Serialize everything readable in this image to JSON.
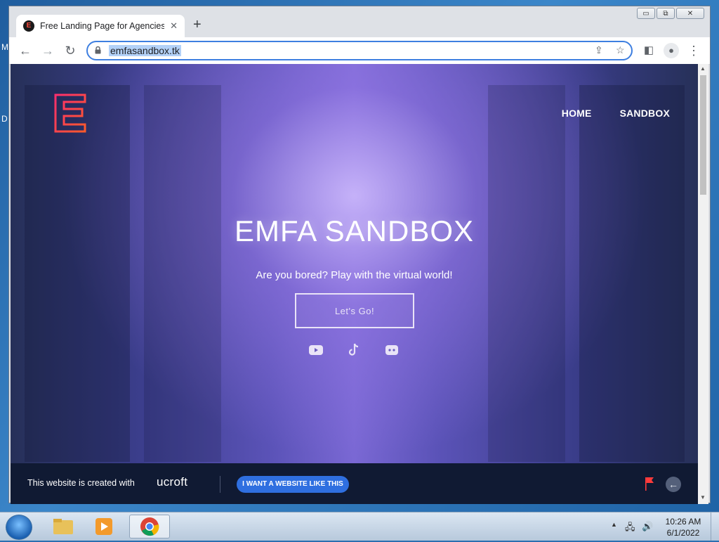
{
  "desktop": {
    "edge_labels": [
      "M",
      "D"
    ]
  },
  "browser": {
    "tab_title": "Free Landing Page for Agencies",
    "favicon_letter": "E",
    "url": "emfasandbox.tk",
    "window_controls": {
      "minimize": "▭",
      "restore": "⧉",
      "close": "✕"
    }
  },
  "page": {
    "nav": [
      "HOME",
      "SANDBOX"
    ],
    "hero_title": "EMFA SANDBOX",
    "hero_subtitle": "Are you bored? Play with the virtual world!",
    "cta_label": "Let's Go!",
    "social_icons": [
      "youtube-icon",
      "tiktok-icon",
      "discord-icon"
    ]
  },
  "promo": {
    "text": "This website is created with",
    "brand": "ucroft",
    "button": "I WANT A WEBSITE LIKE THIS"
  },
  "taskbar": {
    "time": "10:26 AM",
    "date": "6/1/2022"
  },
  "colors": {
    "accent_blue": "#2f6fe0",
    "logo_red": "#ff3b3b",
    "promo_bg": "#101a33"
  }
}
